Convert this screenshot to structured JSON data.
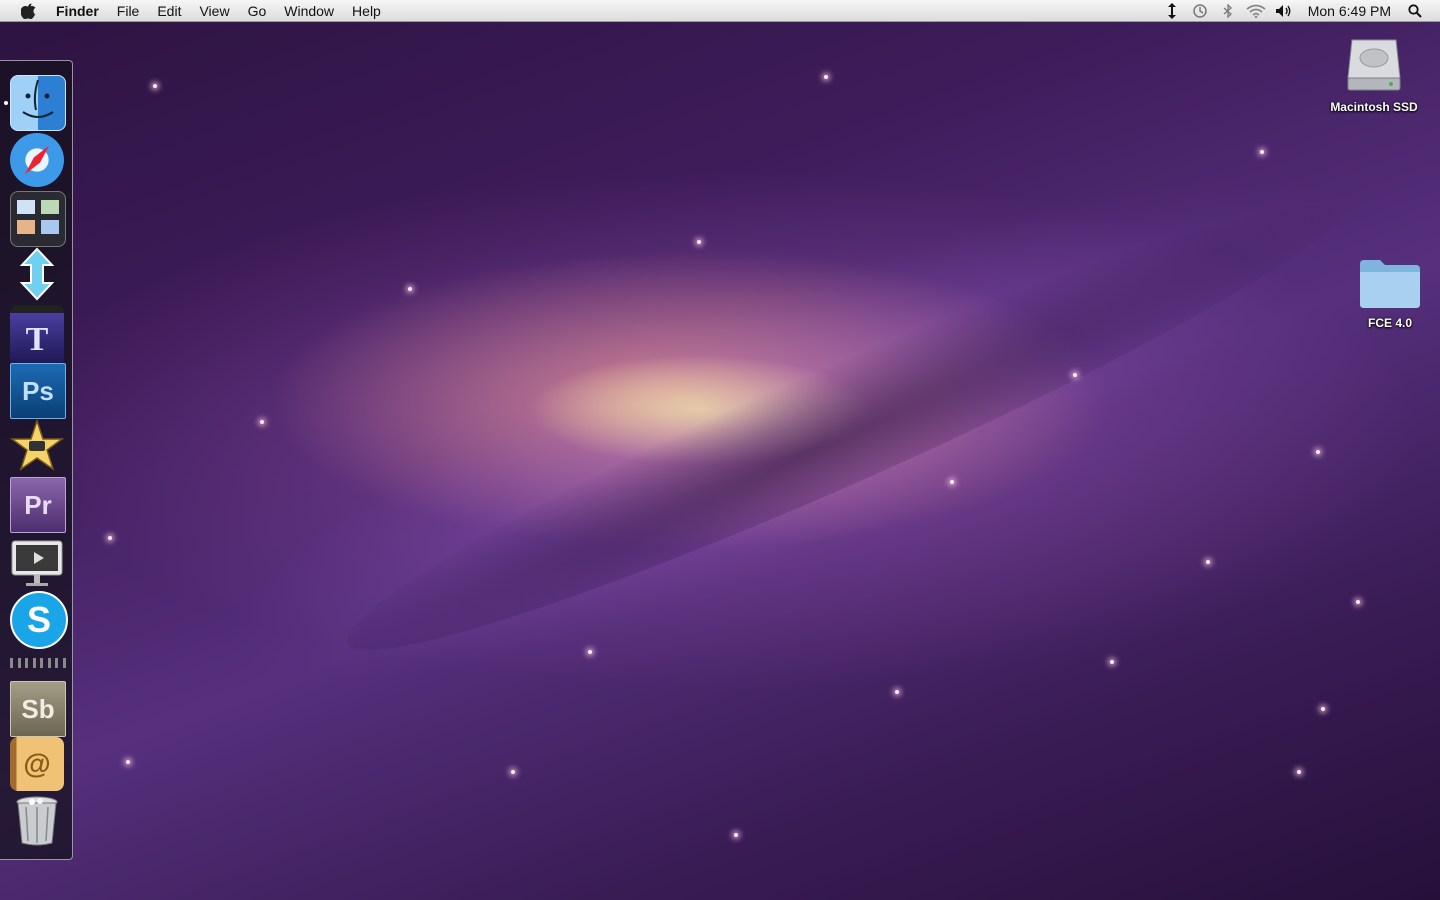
{
  "menubar": {
    "apple_icon": "apple-logo-icon",
    "app_name": "Finder",
    "menus": [
      "File",
      "Edit",
      "View",
      "Go",
      "Window",
      "Help"
    ],
    "status_icons": [
      "sync-arrows-icon",
      "time-machine-icon",
      "bluetooth-icon",
      "wifi-icon",
      "volume-icon"
    ],
    "clock": "Mon 6:49 PM",
    "spotlight_icon": "spotlight-search-icon"
  },
  "dock": {
    "items": [
      {
        "name": "finder-icon"
      },
      {
        "name": "safari-icon"
      },
      {
        "name": "mission-control-icon"
      },
      {
        "name": "resize-arrows-app-icon"
      },
      {
        "name": "titles-app-icon",
        "letter": "T"
      },
      {
        "name": "photoshop-icon",
        "letter": "Ps"
      },
      {
        "name": "imovie-icon"
      },
      {
        "name": "premiere-icon",
        "letter": "Pr"
      },
      {
        "name": "screen-sharing-icon"
      },
      {
        "name": "skype-icon",
        "letter": "S"
      },
      {
        "name": "soundbooth-icon",
        "letter": "Sb"
      },
      {
        "name": "address-book-icon",
        "letter": "@"
      },
      {
        "name": "trash-icon"
      }
    ]
  },
  "desktop": {
    "drive_label": "Macintosh SSD",
    "folder_label": "FCE 4.0"
  },
  "colors": {
    "photoshop": "#0f4c8a",
    "premiere": "#6f4a8e",
    "skype": "#1aa5e8",
    "soundbooth": "#8a8472"
  }
}
